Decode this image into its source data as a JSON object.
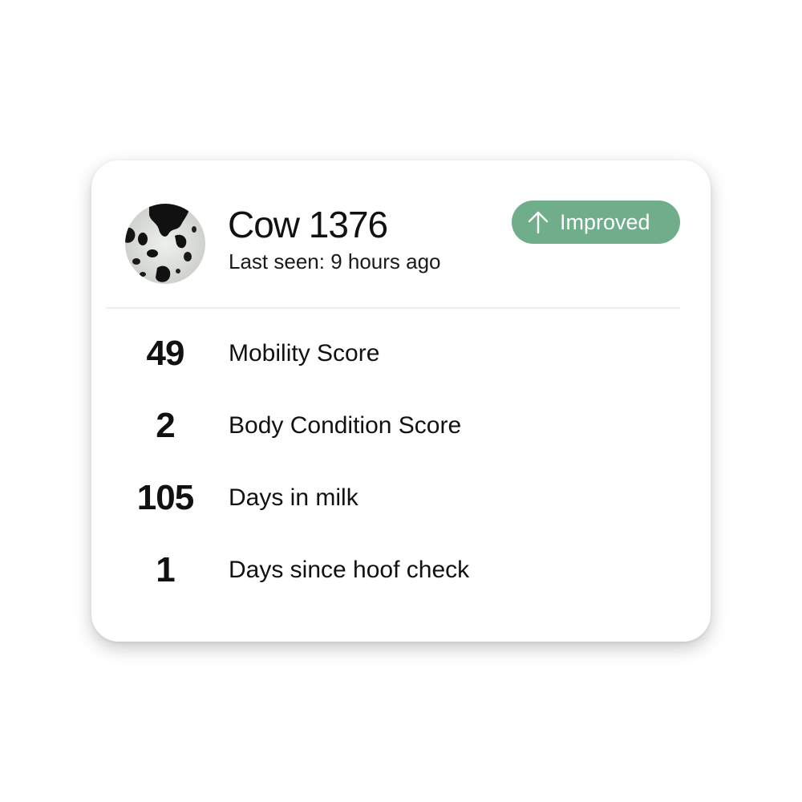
{
  "card": {
    "title": "Cow 1376",
    "last_seen": "Last seen: 9 hours ago",
    "avatar_icon": "cow-hide-avatar",
    "status_badge": {
      "label": "Improved",
      "icon": "arrow-up-icon",
      "color": "#6fad8b"
    }
  },
  "stats": [
    {
      "value": "49",
      "label": "Mobility Score"
    },
    {
      "value": "2",
      "label": "Body Condition Score"
    },
    {
      "value": "105",
      "label": "Days in milk"
    },
    {
      "value": "1",
      "label": "Days since hoof check"
    }
  ]
}
